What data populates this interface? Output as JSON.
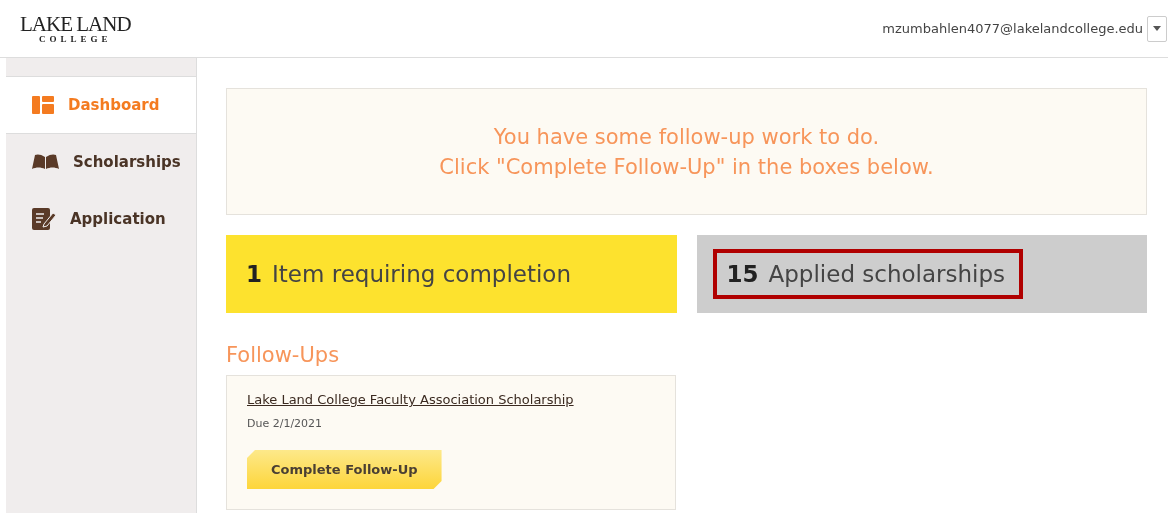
{
  "header": {
    "logo_line_1": "LAKE LAND",
    "logo_line_2": "COLLEGE",
    "user_email": "mzumbahlen4077@lakelandcollege.edu"
  },
  "sidebar": {
    "items": [
      {
        "label": "Dashboard",
        "kind": "dashboard",
        "selected": true
      },
      {
        "label": "Scholarships",
        "kind": "catalog",
        "selected": false
      },
      {
        "label": "Application",
        "kind": "form",
        "selected": false
      }
    ]
  },
  "notice": {
    "line_1": "You have some follow-up work to do.",
    "line_2": "Click \"Complete Follow-Up\" in the boxes below."
  },
  "stats": [
    {
      "count": "1",
      "label": "Item requiring completion",
      "kind": "alert",
      "highlighted": false
    },
    {
      "count": "15",
      "label": "Applied scholarships",
      "kind": "neutral",
      "highlighted": true
    }
  ],
  "follow_ups": {
    "title": "Follow-Ups",
    "items": [
      {
        "name": "Lake Land College Faculty Association Scholarship",
        "due": "Due 2/1/2021",
        "button": "Complete Follow-Up"
      }
    ]
  }
}
